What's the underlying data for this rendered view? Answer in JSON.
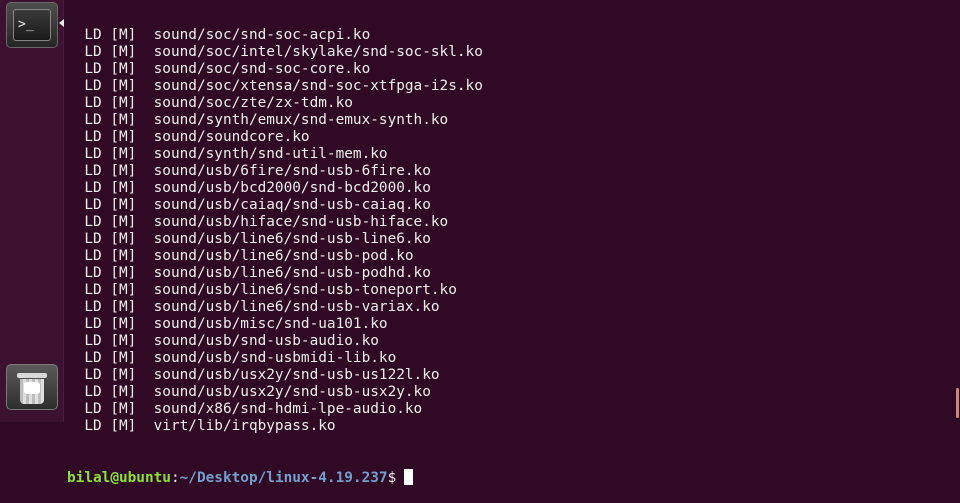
{
  "launcher": {
    "items": [
      {
        "name": "terminal",
        "icon": "terminal-icon",
        "glyph": ">_",
        "active": true
      },
      {
        "name": "trash",
        "icon": "trash-icon"
      }
    ]
  },
  "terminal": {
    "lines": [
      "  LD [M]  sound/soc/snd-soc-acpi.ko",
      "  LD [M]  sound/soc/intel/skylake/snd-soc-skl.ko",
      "  LD [M]  sound/soc/snd-soc-core.ko",
      "  LD [M]  sound/soc/xtensa/snd-soc-xtfpga-i2s.ko",
      "  LD [M]  sound/soc/zte/zx-tdm.ko",
      "  LD [M]  sound/synth/emux/snd-emux-synth.ko",
      "  LD [M]  sound/soundcore.ko",
      "  LD [M]  sound/synth/snd-util-mem.ko",
      "  LD [M]  sound/usb/6fire/snd-usb-6fire.ko",
      "  LD [M]  sound/usb/bcd2000/snd-bcd2000.ko",
      "  LD [M]  sound/usb/caiaq/snd-usb-caiaq.ko",
      "  LD [M]  sound/usb/hiface/snd-usb-hiface.ko",
      "  LD [M]  sound/usb/line6/snd-usb-line6.ko",
      "  LD [M]  sound/usb/line6/snd-usb-pod.ko",
      "  LD [M]  sound/usb/line6/snd-usb-podhd.ko",
      "  LD [M]  sound/usb/line6/snd-usb-toneport.ko",
      "  LD [M]  sound/usb/line6/snd-usb-variax.ko",
      "  LD [M]  sound/usb/misc/snd-ua101.ko",
      "  LD [M]  sound/usb/snd-usb-audio.ko",
      "  LD [M]  sound/usb/snd-usbmidi-lib.ko",
      "  LD [M]  sound/usb/usx2y/snd-usb-us122l.ko",
      "  LD [M]  sound/usb/usx2y/snd-usb-usx2y.ko",
      "  LD [M]  sound/x86/snd-hdmi-lpe-audio.ko",
      "  LD [M]  virt/lib/irqbypass.ko"
    ],
    "prompt": {
      "user_host": "bilal@ubuntu",
      "separator": ":",
      "path": "~/Desktop/linux-4.19.237",
      "symbol": "$"
    }
  },
  "colors": {
    "background": "#300a24",
    "text": "#eeeeec",
    "prompt_user": "#8ae234",
    "prompt_path": "#729fcf"
  }
}
